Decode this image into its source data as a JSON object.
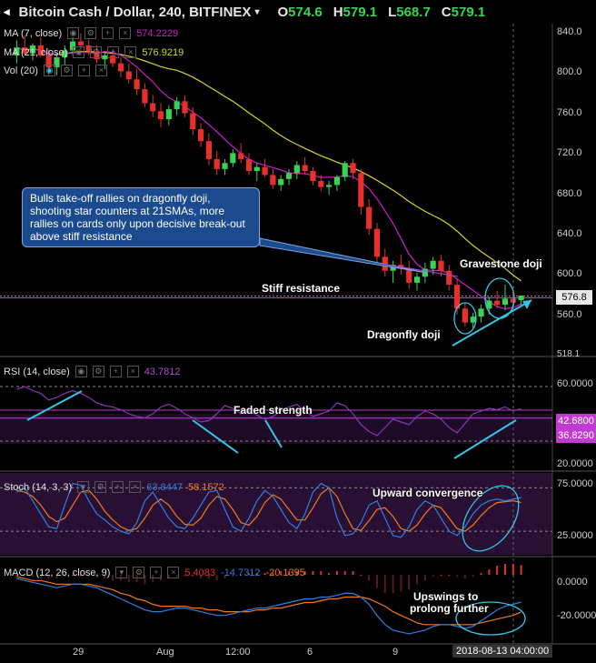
{
  "header": {
    "title": "Bitcoin Cash / Dollar, 240, BITFINEX",
    "ohlc": [
      {
        "key": "O",
        "value": "574.6"
      },
      {
        "key": "H",
        "value": "579.1"
      },
      {
        "key": "L",
        "value": "568.7"
      },
      {
        "key": "C",
        "value": "579.1"
      }
    ]
  },
  "indicators": {
    "ma7": {
      "name": "MA (7, close)",
      "value": "574.2229"
    },
    "ma21": {
      "name": "MA (21, close)",
      "value": "576.9219"
    },
    "vol": {
      "name": "Vol (20)"
    },
    "rsi": {
      "name": "RSI (14, close)",
      "value": "43.7812",
      "tag_upper": "42.6800",
      "tag_lower": "36.8290"
    },
    "stoch": {
      "name": "Stoch (14, 3, 3)",
      "k": "63.8447",
      "d": "58.1572"
    },
    "macd": {
      "name": "MACD (12, 26, close, 9)",
      "hist": "5.4083",
      "macd": "-14.7312",
      "signal": "-20.1395"
    }
  },
  "annotations": {
    "callout": "Bulls take-off rallies on dragonfly doji, shooting star counters at 21SMAs, more rallies on cards only upon decisive break-out above stiff resistance",
    "stiff_resistance": "Stiff resistance",
    "gravestone": "Gravestone doji",
    "dragonfly": "Dragonfly doji",
    "faded": "Faded strength",
    "upward": "Upward convergence",
    "upswings_1": "Upswings to",
    "upswings_2": "prolong further"
  },
  "price_axis": {
    "labels": [
      "840.0",
      "800.0",
      "760.0",
      "720.0",
      "680.0",
      "640.0",
      "600.0",
      "560.0"
    ],
    "last": "576.8",
    "bottom_cut": "518.1"
  },
  "rsi_axis": {
    "labels": [
      "60.0000",
      "20.0000"
    ]
  },
  "stoch_axis": {
    "labels": [
      "75.0000",
      "25.0000"
    ]
  },
  "macd_axis": {
    "labels": [
      "0.0000",
      "-20.0000"
    ]
  },
  "time_axis": {
    "labels": [
      "29",
      "Aug",
      "12:00",
      "6",
      "9"
    ],
    "cursor": "2018-08-13 04:00:00"
  },
  "colors": {
    "up": "#39d353",
    "down": "#e8302b",
    "ma7": "#d01bd0",
    "ma21": "#d6d61e",
    "rsi": "#8a34b8",
    "stoch_k": "#2f7fe0",
    "stoch_d": "#f07a1c",
    "macd": "#2f7fe0",
    "signal": "#f07a1c",
    "cyan": "#33c7e6"
  },
  "chart_data": {
    "type": "candlestick",
    "title": "Bitcoin Cash / Dollar, 240, BITFINEX",
    "ylim": [
      518,
      850
    ],
    "candles": [
      [
        820,
        835,
        812,
        828
      ],
      [
        828,
        840,
        820,
        822
      ],
      [
        822,
        832,
        815,
        830
      ],
      [
        830,
        838,
        818,
        820
      ],
      [
        820,
        826,
        800,
        808
      ],
      [
        808,
        822,
        800,
        818
      ],
      [
        818,
        830,
        810,
        825
      ],
      [
        825,
        838,
        820,
        834
      ],
      [
        834,
        842,
        826,
        830
      ],
      [
        830,
        836,
        820,
        824
      ],
      [
        824,
        830,
        812,
        816
      ],
      [
        816,
        824,
        806,
        820
      ],
      [
        820,
        826,
        808,
        812
      ],
      [
        812,
        818,
        798,
        804
      ],
      [
        804,
        812,
        792,
        796
      ],
      [
        796,
        806,
        780,
        786
      ],
      [
        786,
        792,
        768,
        772
      ],
      [
        772,
        780,
        758,
        764
      ],
      [
        764,
        772,
        748,
        756
      ],
      [
        756,
        770,
        750,
        766
      ],
      [
        766,
        778,
        760,
        774
      ],
      [
        774,
        780,
        758,
        762
      ],
      [
        762,
        768,
        740,
        746
      ],
      [
        746,
        752,
        728,
        734
      ],
      [
        734,
        742,
        710,
        716
      ],
      [
        716,
        724,
        700,
        706
      ],
      [
        706,
        716,
        700,
        712
      ],
      [
        712,
        726,
        708,
        722
      ],
      [
        722,
        732,
        712,
        716
      ],
      [
        716,
        722,
        700,
        704
      ],
      [
        704,
        712,
        694,
        708
      ],
      [
        708,
        716,
        698,
        700
      ],
      [
        700,
        706,
        686,
        690
      ],
      [
        690,
        700,
        684,
        696
      ],
      [
        696,
        706,
        690,
        702
      ],
      [
        702,
        714,
        696,
        710
      ],
      [
        710,
        718,
        700,
        704
      ],
      [
        704,
        708,
        690,
        694
      ],
      [
        694,
        700,
        684,
        688
      ],
      [
        688,
        694,
        680,
        690
      ],
      [
        690,
        700,
        684,
        698
      ],
      [
        698,
        714,
        694,
        712
      ],
      [
        712,
        716,
        696,
        702
      ],
      [
        702,
        706,
        660,
        668
      ],
      [
        668,
        676,
        640,
        646
      ],
      [
        646,
        652,
        612,
        618
      ],
      [
        618,
        626,
        598,
        604
      ],
      [
        604,
        614,
        592,
        610
      ],
      [
        610,
        620,
        600,
        606
      ],
      [
        606,
        614,
        586,
        592
      ],
      [
        592,
        602,
        584,
        598
      ],
      [
        598,
        612,
        592,
        606
      ],
      [
        606,
        618,
        600,
        614
      ],
      [
        614,
        620,
        598,
        604
      ],
      [
        604,
        610,
        584,
        590
      ],
      [
        590,
        596,
        560,
        566
      ],
      [
        566,
        572,
        548,
        552
      ],
      [
        552,
        562,
        546,
        558
      ],
      [
        558,
        570,
        552,
        566
      ],
      [
        566,
        578,
        560,
        574
      ],
      [
        574,
        584,
        566,
        570
      ],
      [
        570,
        590,
        564,
        576
      ],
      [
        576,
        584,
        568,
        572
      ],
      [
        574.6,
        579.1,
        568.7,
        579.1
      ]
    ],
    "ma7_label": "MA (7, close)",
    "ma21_label": "MA (21, close)",
    "rsi": [
      58,
      60,
      57,
      55,
      50,
      52,
      55,
      57,
      55,
      52,
      48,
      46,
      45,
      43,
      40,
      38,
      37,
      40,
      45,
      47,
      44,
      40,
      37,
      34,
      35,
      40,
      46,
      44,
      40,
      42,
      39,
      36,
      38,
      42,
      45,
      47,
      42,
      38,
      40,
      42,
      48,
      46,
      40,
      32,
      27,
      24,
      30,
      36,
      34,
      32,
      38,
      42,
      40,
      36,
      30,
      26,
      33,
      40,
      42,
      44,
      43,
      45,
      42,
      43.78
    ],
    "stoch_k": [
      70,
      75,
      60,
      45,
      30,
      28,
      55,
      80,
      78,
      60,
      45,
      38,
      30,
      25,
      22,
      35,
      60,
      70,
      55,
      40,
      30,
      28,
      40,
      55,
      70,
      72,
      50,
      30,
      25,
      40,
      60,
      72,
      65,
      50,
      35,
      28,
      45,
      70,
      80,
      75,
      40,
      20,
      22,
      35,
      55,
      60,
      40,
      20,
      18,
      30,
      50,
      60,
      55,
      40,
      25,
      20,
      30,
      45,
      55,
      60,
      62,
      60,
      62,
      63.84
    ],
    "stoch_d": [
      72,
      70,
      65,
      55,
      42,
      36,
      40,
      55,
      70,
      72,
      62,
      48,
      38,
      30,
      26,
      28,
      40,
      55,
      62,
      55,
      42,
      33,
      32,
      40,
      55,
      65,
      62,
      50,
      35,
      32,
      42,
      58,
      67,
      62,
      50,
      38,
      38,
      52,
      68,
      75,
      65,
      45,
      28,
      26,
      37,
      50,
      52,
      42,
      28,
      25,
      32,
      45,
      55,
      52,
      40,
      28,
      25,
      32,
      43,
      52,
      58,
      59,
      60,
      58.16
    ],
    "macd": [
      -2,
      -3,
      -4,
      -5,
      -6,
      -7,
      -6,
      -5,
      -5,
      -6,
      -7,
      -9,
      -11,
      -13,
      -15,
      -17,
      -19,
      -20,
      -20,
      -19,
      -18,
      -18,
      -19,
      -20,
      -21,
      -22,
      -22,
      -21,
      -20,
      -19,
      -18,
      -18,
      -17,
      -16,
      -15,
      -14,
      -13,
      -13,
      -12,
      -12,
      -11,
      -10,
      -10,
      -12,
      -16,
      -22,
      -27,
      -30,
      -31,
      -32,
      -31,
      -30,
      -28,
      -27,
      -27,
      -28,
      -29,
      -28,
      -25,
      -22,
      -19,
      -17,
      -16,
      -14.73
    ],
    "signal": [
      -1,
      -2,
      -3,
      -3,
      -4,
      -5,
      -5,
      -5,
      -5,
      -5,
      -6,
      -7,
      -8,
      -10,
      -11,
      -13,
      -14,
      -16,
      -17,
      -17,
      -17,
      -17,
      -18,
      -18,
      -19,
      -19,
      -20,
      -20,
      -20,
      -20,
      -19,
      -19,
      -18,
      -18,
      -17,
      -16,
      -15,
      -15,
      -14,
      -13,
      -13,
      -12,
      -12,
      -12,
      -13,
      -15,
      -17,
      -20,
      -22,
      -24,
      -26,
      -27,
      -27,
      -27,
      -27,
      -27,
      -27,
      -27,
      -26,
      -25,
      -24,
      -23,
      -22,
      -20.14
    ],
    "rsi_levels": [
      60,
      42.68,
      36.829,
      20
    ],
    "stoch_levels": [
      75,
      25
    ]
  }
}
